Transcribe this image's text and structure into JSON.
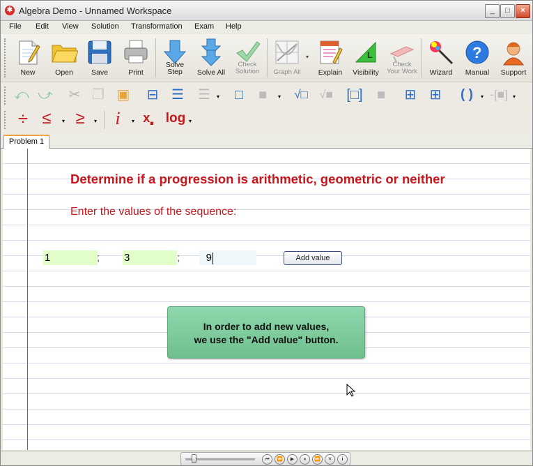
{
  "window": {
    "title": "Algebra Demo - Unnamed Workspace",
    "minimize": "_",
    "maximize": "□",
    "close": "×"
  },
  "menu": [
    "File",
    "Edit",
    "View",
    "Solution",
    "Transformation",
    "Exam",
    "Help"
  ],
  "toolbar": {
    "new": "New",
    "open": "Open",
    "save": "Save",
    "print": "Print",
    "solve_step_1": "Solve",
    "solve_step_2": "Step",
    "solve_all": "Solve All",
    "check_solution_1": "Check",
    "check_solution_2": "Solution",
    "graph_all": "Graph All",
    "explain": "Explain",
    "visibility": "Visibility",
    "check_your_work_1": "Check",
    "check_your_work_2": "Your Work",
    "wizard": "Wizard",
    "manual": "Manual",
    "support": "Support"
  },
  "math_toolbar": {
    "divide": "÷",
    "less_equal": "≤",
    "greater_equal": "≥",
    "imaginary": "i",
    "subscript": "x",
    "log": "log",
    "parentheses": "( )",
    "dropdown": "▾"
  },
  "tabs": [
    "Problem 1"
  ],
  "problem": {
    "heading": "Determine if a progression is arithmetic, geometric or neither",
    "instruction": "Enter the values of the sequence:",
    "values": [
      "1",
      "3",
      "9"
    ],
    "separator": ";",
    "add_value_button": "Add value",
    "note_line1": "In order to add new values,",
    "note_line2": "we use the \"Add value\" button."
  },
  "colors": {
    "heading": "#c8161a",
    "value_field": "#e1fdc8",
    "note": "#7ccb9b",
    "margin_line": "#c8443e"
  },
  "player": {
    "first": "⏮",
    "prev": "⏪",
    "play": "▶",
    "pause": "⏸",
    "next": "⏩",
    "stop": "✕",
    "info": "i",
    "position": 0.1
  }
}
